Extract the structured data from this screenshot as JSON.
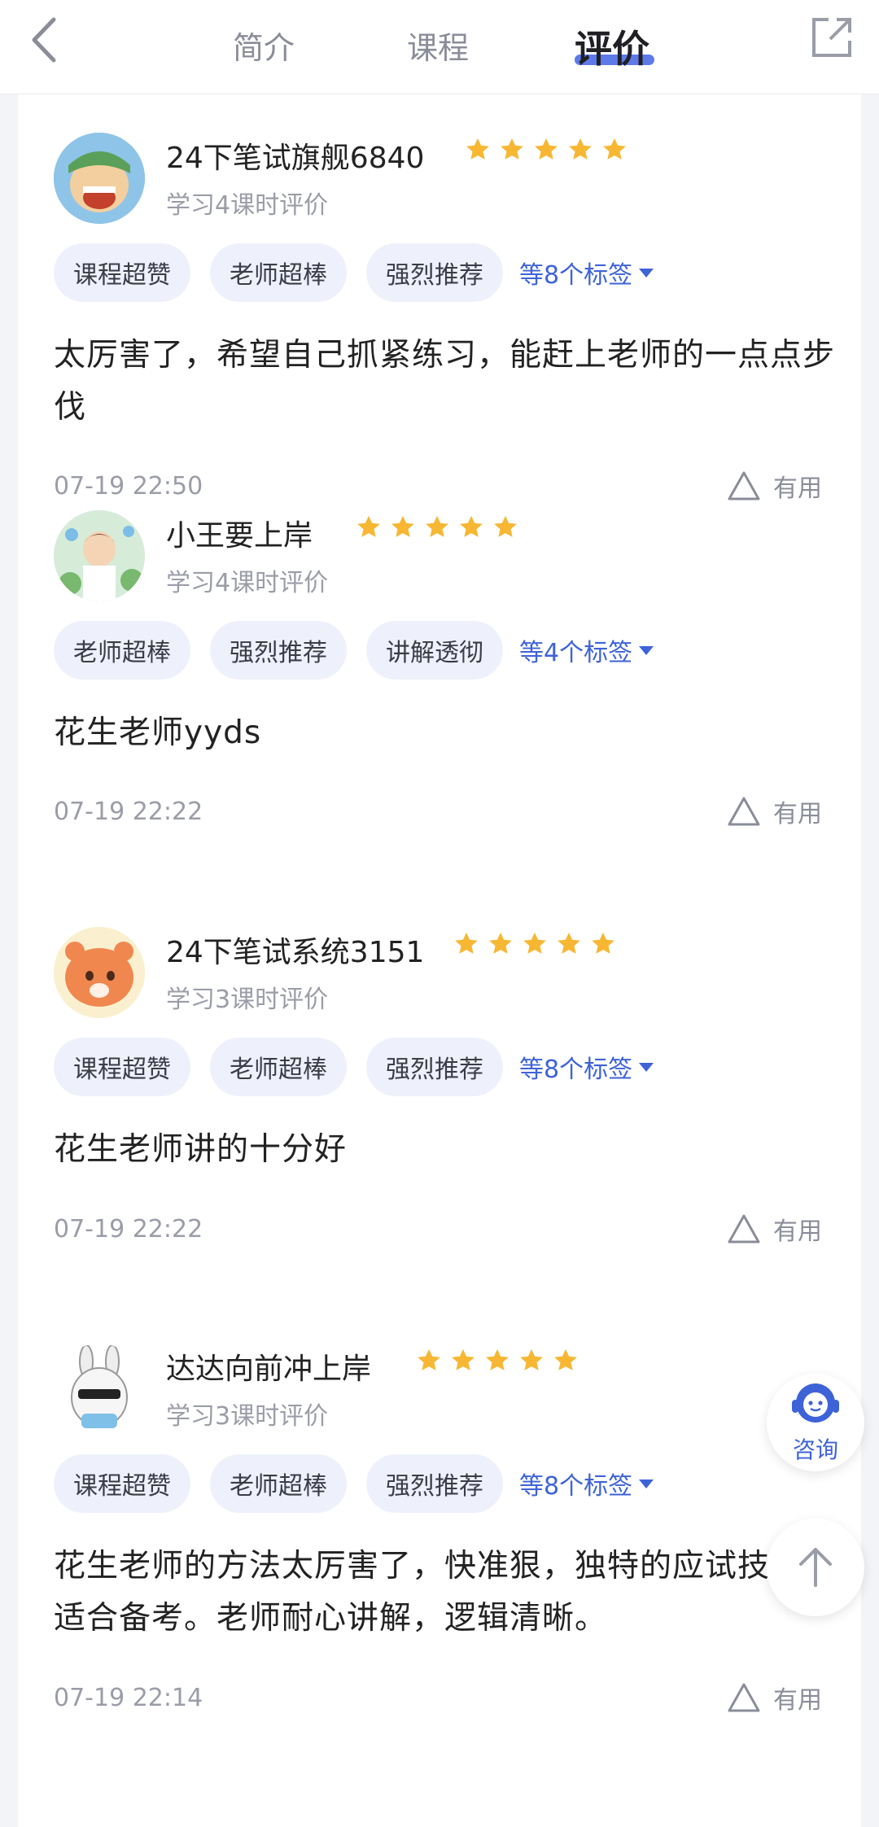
{
  "header": {
    "tabs": [
      {
        "label": "简介",
        "active": false
      },
      {
        "label": "课程",
        "active": false
      },
      {
        "label": "评价",
        "active": true
      }
    ],
    "icons": {
      "back": "chevron-left-icon",
      "share": "share-icon"
    }
  },
  "colors": {
    "accent": "#3e63d8",
    "star": "#f7b733",
    "tag_bg": "#eef1fb",
    "muted": "#9a9da8"
  },
  "reviews": [
    {
      "name": "24下笔试旗舰6840",
      "rating": 5,
      "meta": "学习4课时评价",
      "tags": [
        "课程超赞",
        "老师超棒",
        "强烈推荐"
      ],
      "more_tags": "等8个标签",
      "text": "太厉害了，希望自己抓紧练习，能赶上老师的一点点步伐",
      "time": "07-19 22:50",
      "useful_label": "有用"
    },
    {
      "name": "小王要上岸",
      "rating": 5,
      "meta": "学习4课时评价",
      "tags": [
        "老师超棒",
        "强烈推荐",
        "讲解透彻"
      ],
      "more_tags": "等4个标签",
      "text": "花生老师yyds",
      "time": "07-19 22:22",
      "useful_label": "有用"
    },
    {
      "name": "24下笔试系统3151",
      "rating": 5,
      "meta": "学习3课时评价",
      "tags": [
        "课程超赞",
        "老师超棒",
        "强烈推荐"
      ],
      "more_tags": "等8个标签",
      "text": "花生老师讲的十分好",
      "time": "07-19 22:22",
      "useful_label": "有用"
    },
    {
      "name": "达达向前冲上岸",
      "rating": 5,
      "meta": "学习3课时评价",
      "tags": [
        "课程超赞",
        "老师超棒",
        "强烈推荐"
      ],
      "more_tags": "等8个标签",
      "text": "花生老师的方法太厉害了，快准狠，独特的应试技巧很适合备考。老师耐心讲解，逻辑清晰。",
      "time": "07-19 22:14",
      "useful_label": "有用"
    }
  ],
  "floating": {
    "consult_label": "咨询",
    "consult_icon": "customer-service-icon",
    "top_icon": "arrow-up-icon"
  }
}
